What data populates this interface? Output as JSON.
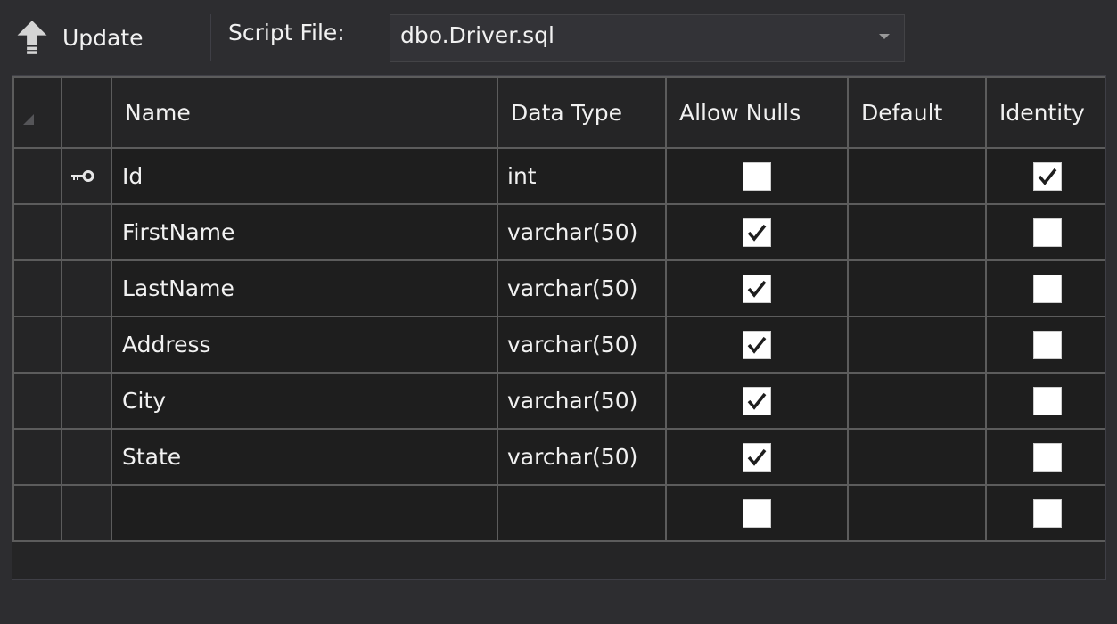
{
  "toolbar": {
    "update_label": "Update",
    "script_file_label": "Script File:",
    "script_file_value": "dbo.Driver.sql"
  },
  "grid": {
    "columns": [
      "Name",
      "Data Type",
      "Allow Nulls",
      "Default",
      "Identity"
    ],
    "rows": [
      {
        "name": "Id",
        "data_type": "int",
        "allow_nulls": false,
        "default": "",
        "identity": true,
        "primary_key": true
      },
      {
        "name": "FirstName",
        "data_type": "varchar(50)",
        "allow_nulls": true,
        "default": "",
        "identity": false,
        "primary_key": false
      },
      {
        "name": "LastName",
        "data_type": "varchar(50)",
        "allow_nulls": true,
        "default": "",
        "identity": false,
        "primary_key": false
      },
      {
        "name": "Address",
        "data_type": "varchar(50)",
        "allow_nulls": true,
        "default": "",
        "identity": false,
        "primary_key": false
      },
      {
        "name": "City",
        "data_type": "varchar(50)",
        "allow_nulls": true,
        "default": "",
        "identity": false,
        "primary_key": false
      },
      {
        "name": "State",
        "data_type": "varchar(50)",
        "allow_nulls": true,
        "default": "",
        "identity": false,
        "primary_key": false
      },
      {
        "name": "",
        "data_type": "",
        "allow_nulls": false,
        "default": "",
        "identity": false,
        "primary_key": false
      }
    ]
  },
  "icons": {
    "update": "upload-arrow-icon",
    "primary_key": "key-icon",
    "dropdown": "chevron-down-icon",
    "check": "checkmark-icon"
  },
  "colors": {
    "background": "#2d2d30",
    "grid_background": "#1e1e1e",
    "grid_line": "#5c5c5c",
    "text": "#f1f1f1",
    "checkbox": "#ffffff"
  }
}
